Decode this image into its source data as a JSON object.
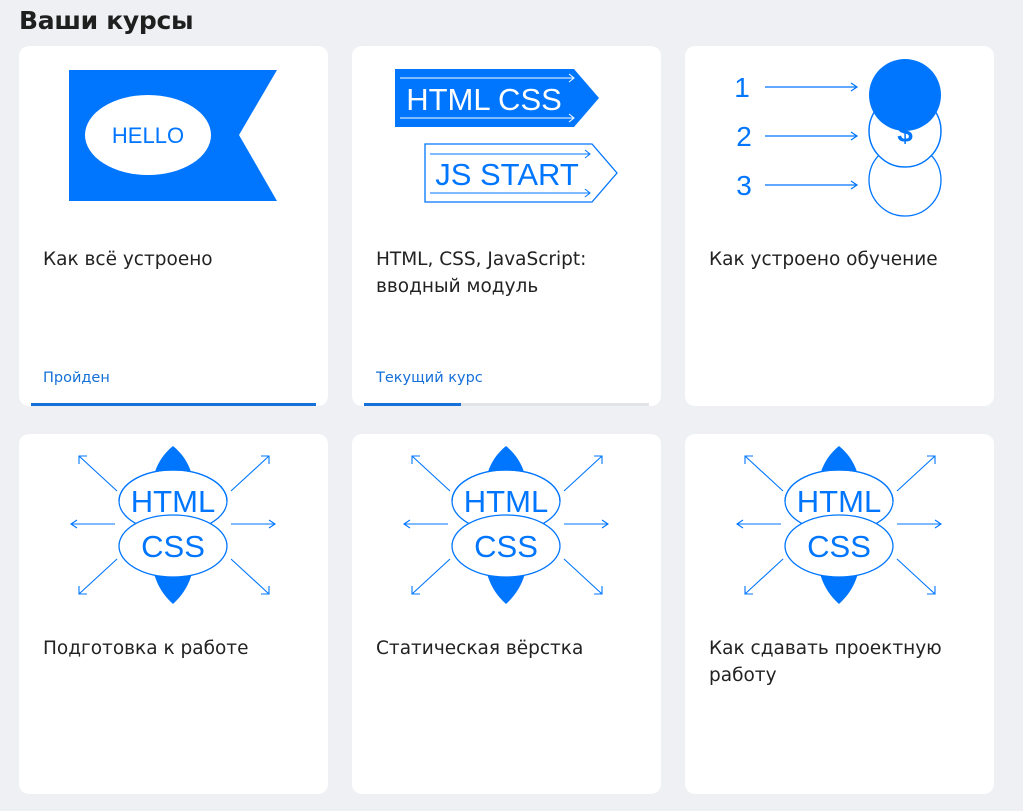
{
  "page": {
    "title": "Ваши курсы"
  },
  "colors": {
    "accent": "#0076ff",
    "status": "#1570d8",
    "background": "#eef0f4",
    "card": "#ffffff"
  },
  "courses": [
    {
      "title": "Как всё устроено",
      "status": "Пройден",
      "progress": 1.0,
      "image": {
        "icon": "hello-flag-icon",
        "text": "HELLO"
      }
    },
    {
      "title": "HTML, CSS, JavaScript: вводный модуль",
      "status": "Текущий курс",
      "progress": 0.34,
      "image": {
        "icon": "html-css-js-arrows-icon",
        "text1": "HTML CSS",
        "text2": "JS START"
      }
    },
    {
      "title": "Как устроено обучение",
      "status": "",
      "image": {
        "icon": "numbered-coins-icon",
        "nums": [
          "1",
          "2",
          "3"
        ],
        "symbol": "$"
      }
    },
    {
      "title": "Подготовка к работе",
      "status": "",
      "image": {
        "icon": "html-css-burst-icon",
        "text1": "HTML",
        "text2": "CSS"
      }
    },
    {
      "title": "Статическая вёрстка",
      "status": "",
      "image": {
        "icon": "html-css-burst-icon",
        "text1": "HTML",
        "text2": "CSS"
      }
    },
    {
      "title": "Как сдавать проектную работу",
      "status": "",
      "image": {
        "icon": "html-css-burst-icon",
        "text1": "HTML",
        "text2": "CSS"
      }
    }
  ]
}
